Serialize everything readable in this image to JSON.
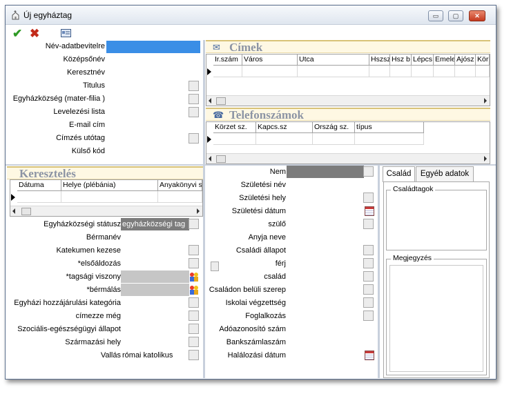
{
  "window": {
    "title": "Új egyháztag",
    "minimize": "▭",
    "maximize": "▢",
    "close": "✕"
  },
  "toolbar": {
    "ok": "✔",
    "cancel": "✖"
  },
  "top_form": [
    {
      "label": "Név-adatbevitelre",
      "value": ""
    },
    {
      "label": "Középsőnév",
      "value": ""
    },
    {
      "label": "Keresztnév",
      "value": ""
    },
    {
      "label": "Titulus",
      "value": ""
    },
    {
      "label": "Egyházközség (mater-filia )",
      "value": ""
    },
    {
      "label": "Levelezési lista",
      "value": ""
    },
    {
      "label": "E-mail cím",
      "value": ""
    },
    {
      "label": "Címzés utótag",
      "value": ""
    },
    {
      "label": "Külső kód",
      "value": ""
    }
  ],
  "cimek": {
    "title": "Címek",
    "columns": [
      "Ir.szám",
      "Város",
      "Utca",
      "Hszsz",
      "Hsz b",
      "Lépcs",
      "Emele",
      "Ajósz",
      "Kör"
    ]
  },
  "telefon": {
    "title": "Telefonszámok",
    "columns": [
      "Körzet sz.",
      "Kapcs.sz",
      "Ország sz.",
      "típus"
    ]
  },
  "kereszteles": {
    "title": "Keresztelés",
    "columns": [
      "Dátuma",
      "Helye (plébánia)",
      "Anyakönyvi s"
    ]
  },
  "left_form": [
    {
      "label": "Egyházközségi státusz",
      "value": "egyházközségi tag"
    },
    {
      "label": "Bérmanév",
      "value": ""
    },
    {
      "label": "Katekumen kezese",
      "value": ""
    },
    {
      "label": "*elsőáldozás",
      "value": ""
    },
    {
      "label": "*tagsági viszony",
      "value": ""
    },
    {
      "label": "*bérmálás",
      "value": ""
    },
    {
      "label": "Egyházi hozzájárulási kategória",
      "value": ""
    },
    {
      "label": "címezze még",
      "value": ""
    },
    {
      "label": "Szociális-egészségügyi állapot",
      "value": ""
    },
    {
      "label": "Származási hely",
      "value": ""
    },
    {
      "label": "Vallás",
      "value": "római katolikus"
    }
  ],
  "mid_form": [
    {
      "label": "Nem",
      "value": ""
    },
    {
      "label": "Születési név",
      "value": ""
    },
    {
      "label": "Születési hely",
      "value": ""
    },
    {
      "label": "Születési dátum",
      "value": ""
    },
    {
      "label": "szülő",
      "value": ""
    },
    {
      "label": "Anyja neve",
      "value": ""
    },
    {
      "label": "Családi állapot",
      "value": ""
    },
    {
      "label": "férj",
      "value": ""
    },
    {
      "label": "család",
      "value": ""
    },
    {
      "label": "Családon belüli szerep",
      "value": ""
    },
    {
      "label": "Iskolai végzettség",
      "value": ""
    },
    {
      "label": "Foglalkozás",
      "value": ""
    },
    {
      "label": "Adóazonosító szám",
      "value": ""
    },
    {
      "label": "Bankszámlaszám",
      "value": ""
    },
    {
      "label": "Halálozási dátum",
      "value": ""
    }
  ],
  "right_panel": {
    "tabs": [
      "Család",
      "Egyéb adatok"
    ],
    "groups": [
      "Családtagok",
      "Megjegyzés"
    ]
  },
  "colors": {
    "accent": "#3a8ee6",
    "section_bg": "#fef8e3",
    "section_title": "#8c94a4"
  }
}
